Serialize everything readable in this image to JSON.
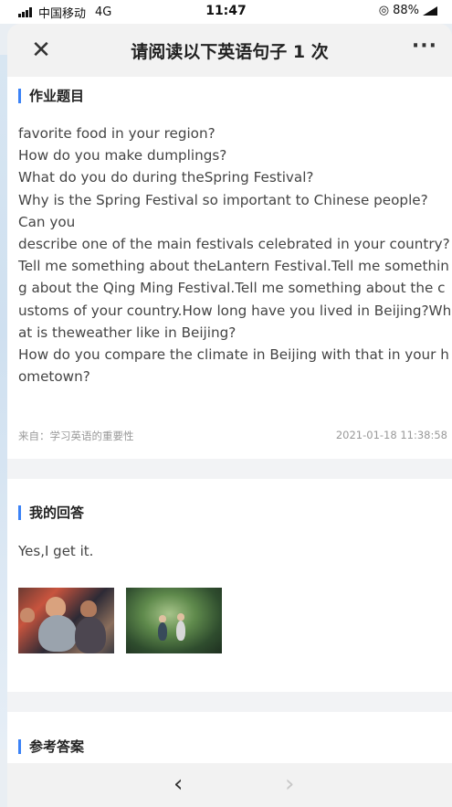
{
  "status_bar": {
    "carrier": "中国移动",
    "network": "4G",
    "time": "11:47",
    "battery": "88%"
  },
  "header": {
    "title": "请阅读以下英语句子 1 次",
    "close_icon": "close-icon",
    "more_icon": "more-icon"
  },
  "question_section": {
    "title": "作业题目",
    "text": "favorite food in your region?\nHow do you make dumplings?\nWhat do you do during theSpring Festival?\nWhy is the Spring Festival so important to Chinese people?\nCan you\ndescribe one of the main festivals celebrated in your country?\nTell me something about theLantern Festival.Tell me something about the Qing Ming Festival.Tell me something about the customs of your country.How long have you lived in Beijing?What is theweather like in Beijing?\nHow do you compare the climate in Beijing with that in your hometown?",
    "source": "来自：学习英语的重要性",
    "date": "2021-01-18 11:38:58"
  },
  "answer_section": {
    "title": "我的回答",
    "text": "Yes,I get it.",
    "images": [
      "classroom-photo",
      "forest-photo"
    ]
  },
  "reference_section": {
    "title": "参考答案"
  },
  "footer": {
    "prev_icon": "chevron-left-icon",
    "next_icon": "chevron-right-icon"
  },
  "colors": {
    "accent": "#3b82f6",
    "header_bg": "#f2f2f2",
    "band_bg": "#f2f3f5"
  }
}
